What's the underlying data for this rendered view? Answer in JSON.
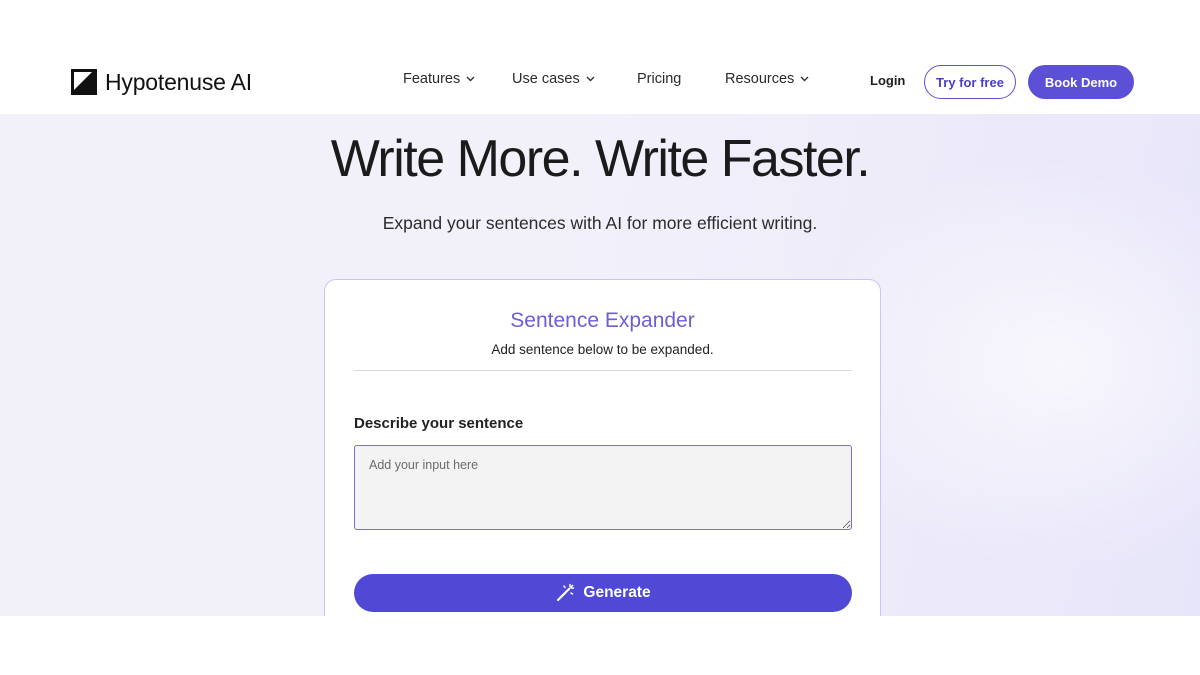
{
  "header": {
    "brand": "Hypotenuse AI",
    "nav": [
      {
        "label": "Features",
        "has_dropdown": true
      },
      {
        "label": "Use cases",
        "has_dropdown": true
      },
      {
        "label": "Pricing",
        "has_dropdown": false
      },
      {
        "label": "Resources",
        "has_dropdown": true
      }
    ],
    "login_label": "Login",
    "try_label": "Try for free",
    "demo_label": "Book Demo"
  },
  "hero": {
    "title": "Write More. Write Faster.",
    "subtitle": "Expand your sentences with AI for more efficient writing."
  },
  "tool": {
    "title": "Sentence Expander",
    "subtitle": "Add sentence below to be expanded.",
    "field_label": "Describe your sentence",
    "input_value": "",
    "input_placeholder": "Add your input here",
    "generate_label": "Generate",
    "generate_icon": "magic-wand-icon"
  },
  "colors": {
    "accent": "#5b50d6",
    "accent_text": "#6a5fd9",
    "hero_bg": "#f2f1fa"
  }
}
